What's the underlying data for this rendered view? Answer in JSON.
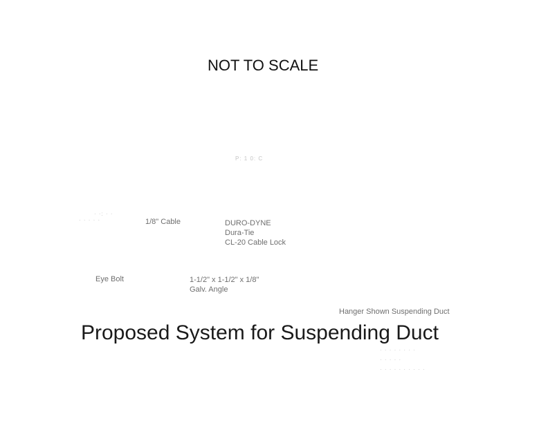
{
  "drawing": {
    "scale_note": "NOT TO SCALE",
    "title": "Proposed System for Suspending Duct",
    "labels": {
      "top_fragment": "P:  1  0:  C",
      "left_fragment_1": "·  ·:    ·  ·",
      "left_fragment_2": "·  ·  ·  ·    ·",
      "cable": "1/8\" Cable",
      "brand": "DURO-DYNE",
      "product": "Dura-Tie",
      "cable_lock": "CL-20 Cable Lock",
      "eye_bolt": "Eye Bolt",
      "angle_size": "1-1/2\" x 1-1/2\" x 1/8\"",
      "angle_type": "Galv. Angle",
      "hanger_note": "Hanger Shown Suspending Duct",
      "block_line_1": "·  ·  ·  ·  ·  ·  ·  ·",
      "block_line_2": "·  ·  ·  ·  ·",
      "block_line_3": "·  ·  ·  ·  ·  ·  ·  ·  ·  ·"
    }
  }
}
